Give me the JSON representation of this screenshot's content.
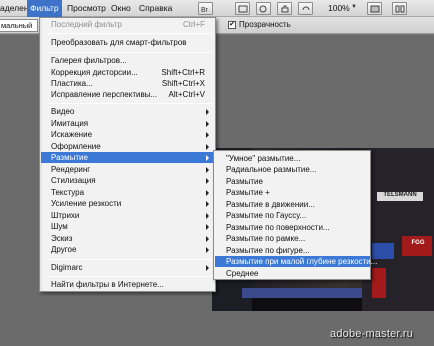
{
  "menubar": {
    "items": [
      {
        "label": "аделение",
        "active": false
      },
      {
        "label": "Фильтр",
        "active": true
      },
      {
        "label": "Просмотр",
        "active": false
      },
      {
        "label": "Окно",
        "active": false
      },
      {
        "label": "Справка",
        "active": false
      }
    ],
    "zoom": "100%"
  },
  "options_bar": {
    "mode_value": "мальный",
    "transparency_label": "Прозрачность",
    "transparency_checked": "✔"
  },
  "filter_menu": {
    "last_filter": {
      "label": "Последний фильтр",
      "shortcut": "Ctrl+F"
    },
    "convert": {
      "label": "Преобразовать для смарт-фильтров"
    },
    "gallery": {
      "label": "Галерея фильтров..."
    },
    "lens": {
      "label": "Коррекция дисторсии...",
      "shortcut": "Shift+Ctrl+R"
    },
    "liquify": {
      "label": "Пластика...",
      "shortcut": "Shift+Ctrl+X"
    },
    "vanishing": {
      "label": "Исправление перспективы...",
      "shortcut": "Alt+Ctrl+V"
    },
    "groups": [
      {
        "label": "Видео"
      },
      {
        "label": "Имитация"
      },
      {
        "label": "Искажение"
      },
      {
        "label": "Оформление"
      },
      {
        "label": "Размытие",
        "highlighted": true
      },
      {
        "label": "Рендеринг"
      },
      {
        "label": "Стилизация"
      },
      {
        "label": "Текстура"
      },
      {
        "label": "Усиление резкости"
      },
      {
        "label": "Штрихи"
      },
      {
        "label": "Шум"
      },
      {
        "label": "Эскиз"
      },
      {
        "label": "Другое"
      }
    ],
    "digimarc": {
      "label": "Digimarc"
    },
    "browse": {
      "label": "Найти фильтры в Интернете..."
    }
  },
  "blur_submenu": {
    "items": [
      {
        "label": "\"Умное\" размытие..."
      },
      {
        "label": "Радиальное размытие..."
      },
      {
        "label": "Размытие"
      },
      {
        "label": "Размытие +"
      },
      {
        "label": "Размытие в движении..."
      },
      {
        "label": "Размытие по Гауссу..."
      },
      {
        "label": "Размытие по поверхности..."
      },
      {
        "label": "Размытие по рамке..."
      },
      {
        "label": "Размытие по фигуре..."
      },
      {
        "label": "Размытие при малой глубине резкости...",
        "highlighted": true
      },
      {
        "label": "Среднее"
      }
    ]
  },
  "photo_signs": {
    "sign1": "TELSMANN",
    "sign2": "FGG"
  },
  "watermark": "adobe-master.ru",
  "colors": {
    "highlight": "#3c79d7",
    "menu_bg": "#f2f2f2",
    "menubar_active": "#3d73c9"
  }
}
